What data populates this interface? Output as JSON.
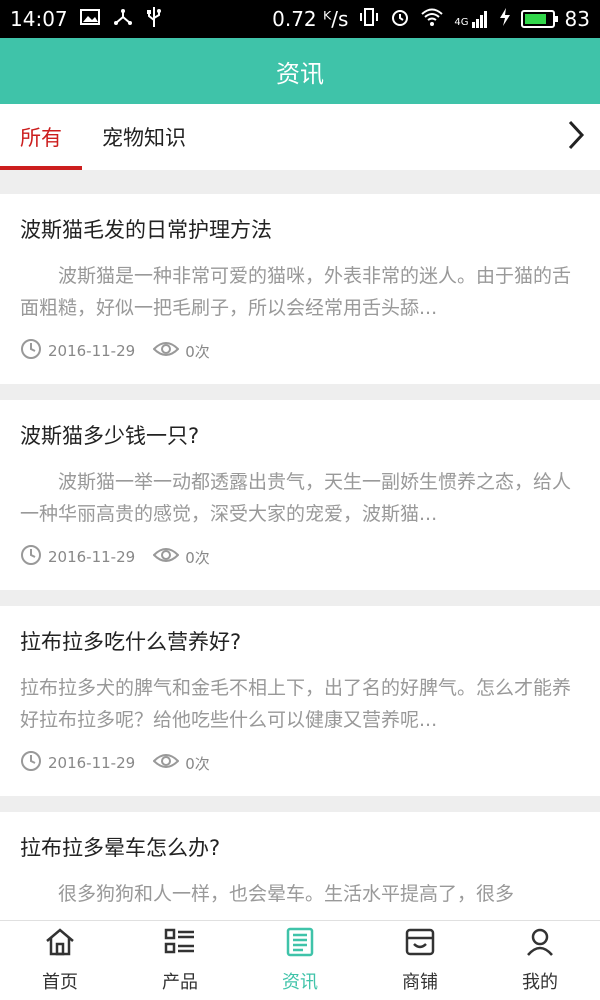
{
  "status_bar": {
    "time": "14:07",
    "network_speed": "0.72 ᴷ/s",
    "battery": "83",
    "signal_label": "4G"
  },
  "header": {
    "title": "资讯"
  },
  "tabs": [
    {
      "label": "所有",
      "active": true
    },
    {
      "label": "宠物知识",
      "active": false
    }
  ],
  "articles": [
    {
      "title": "波斯猫毛发的日常护理方法",
      "summary": "　　波斯猫是一种非常可爱的猫咪，外表非常的迷人。由于猫的舌面粗糙，好似一把毛刷子，所以会经常用舌头舔...",
      "date": "2016-11-29",
      "views": "0次"
    },
    {
      "title": "波斯猫多少钱一只?",
      "summary": "　　波斯猫一举一动都透露出贵气，天生一副娇生惯养之态，给人一种华丽高贵的感觉，深受大家的宠爱，波斯猫...",
      "date": "2016-11-29",
      "views": "0次"
    },
    {
      "title": "拉布拉多吃什么营养好?",
      "summary": "拉布拉多犬的脾气和金毛不相上下，出了名的好脾气。怎么才能养好拉布拉多呢？给他吃些什么可以健康又营养呢...",
      "date": "2016-11-29",
      "views": "0次"
    },
    {
      "title": "拉布拉多晕车怎么办?",
      "summary": "　　很多狗狗和人一样，也会晕车。生活水平提高了，很多",
      "date": "",
      "views": ""
    }
  ],
  "bottom_nav": [
    {
      "label": "首页",
      "icon": "home-icon",
      "active": false
    },
    {
      "label": "产品",
      "icon": "list-icon",
      "active": false
    },
    {
      "label": "资讯",
      "icon": "news-icon",
      "active": true
    },
    {
      "label": "商铺",
      "icon": "shop-icon",
      "active": false
    },
    {
      "label": "我的",
      "icon": "user-icon",
      "active": false
    }
  ],
  "colors": {
    "accent": "#3fc3a9",
    "active_tab": "#cc1e1e"
  }
}
